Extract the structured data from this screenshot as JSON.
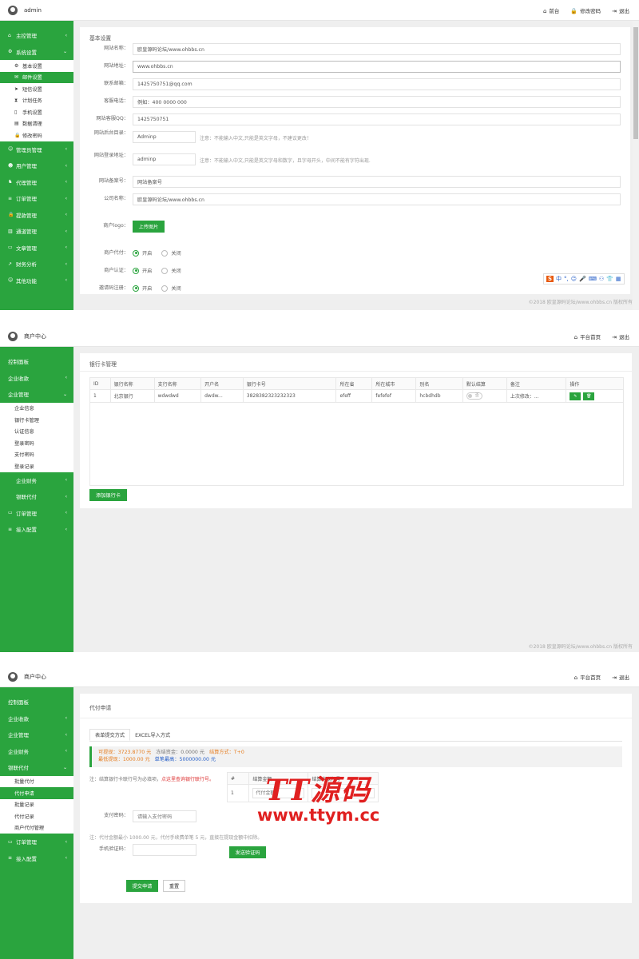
{
  "panel1": {
    "user": "admin",
    "top_links": [
      {
        "icon": "home-icon",
        "glyph": "⌂",
        "label": "前台"
      },
      {
        "icon": "lock-icon",
        "glyph": "🔒",
        "label": "修改密码"
      },
      {
        "icon": "logout-icon",
        "glyph": "⇥",
        "label": "退出"
      }
    ],
    "nav_top": [
      {
        "label": "主控管理",
        "icon": "home-icon",
        "glyph": "⌂",
        "chev": "‹"
      },
      {
        "label": "系统设置",
        "icon": "gears-icon",
        "glyph": "⚙",
        "chev": "⌄"
      }
    ],
    "sub_items": [
      {
        "label": "基本设置",
        "icon": "gear-icon",
        "glyph": "⚙",
        "active": false
      },
      {
        "label": "邮件设置",
        "icon": "envelope-icon",
        "glyph": "✉",
        "active": true
      },
      {
        "label": "短信设置",
        "icon": "paper-plane-icon",
        "glyph": "➤",
        "active": false
      },
      {
        "label": "计划任务",
        "icon": "hourglass-icon",
        "glyph": "⧗",
        "active": false
      },
      {
        "label": "手机设置",
        "icon": "mobile-icon",
        "glyph": "▯",
        "active": false
      },
      {
        "label": "数据清理",
        "icon": "database-icon",
        "glyph": "▤",
        "active": false
      },
      {
        "label": "修改密码",
        "icon": "lock-icon",
        "glyph": "🔒",
        "active": false
      }
    ],
    "nav_bottom": [
      {
        "label": "管理员管理",
        "icon": "user-shield-icon",
        "glyph": "☺"
      },
      {
        "label": "用户管理",
        "icon": "users-icon",
        "glyph": "☻"
      },
      {
        "label": "代理管理",
        "icon": "agent-icon",
        "glyph": "♞"
      },
      {
        "label": "订单管理",
        "icon": "list-icon",
        "glyph": "≡"
      },
      {
        "label": "提款管理",
        "icon": "lock-icon",
        "glyph": "🔒"
      },
      {
        "label": "通道管理",
        "icon": "bank-icon",
        "glyph": "▥"
      },
      {
        "label": "文章管理",
        "icon": "folder-icon",
        "glyph": "▭"
      },
      {
        "label": "财务分析",
        "icon": "chart-icon",
        "glyph": "↗"
      },
      {
        "label": "其他功能",
        "icon": "user-icon",
        "glyph": "☺"
      }
    ],
    "card_title": "基本设置",
    "fields": [
      {
        "label": "网站名称：",
        "value": "欧皇源码论坛/www.ohbbs.cn",
        "note": ""
      },
      {
        "label": "网站地址：",
        "value": "www.ohbbs.cn",
        "note": ""
      },
      {
        "label": "联系邮箱：",
        "value": "1425750751@qq.com",
        "note": ""
      },
      {
        "label": "客服电话：",
        "value": "例如：400 0000 000",
        "note": ""
      },
      {
        "label": "网站客服QQ：",
        "value": "1425750751",
        "note": ""
      },
      {
        "label": "网站后台目录：",
        "value": "Adminp",
        "note": "注意：不能输入中文,只能是英文字母，不建议更改！"
      },
      {
        "label": "网站登录地址：",
        "value": "adminp",
        "note": "注意：不能输入中文,只能是英文字母和数字，且字母开头，中间不能有字符出现."
      },
      {
        "label": "网站备案号：",
        "value": "网站备案号",
        "note": ""
      },
      {
        "label": "公司名称：",
        "value": "欧皇源码论坛/www.ohbbs.cn",
        "note": ""
      }
    ],
    "logo_label": "商户logo：",
    "upload_label": "上传图片",
    "radios": [
      {
        "label": "商户代付：",
        "on": "开启",
        "off": "关闭"
      },
      {
        "label": "商户认证：",
        "on": "开启",
        "off": "关闭"
      },
      {
        "label": "邀请码注册：",
        "on": "开启",
        "off": "关闭"
      }
    ],
    "ime": {
      "s_glyph": "S",
      "items": [
        "中",
        "°,",
        "☺",
        "🎤",
        "⌨",
        "⚇",
        "👕",
        "▦"
      ]
    },
    "footer": "©2018 欧皇源码论坛/www.ohbbs.cn 版权所有"
  },
  "panel2": {
    "user": "商户中心",
    "top_links": [
      {
        "icon": "home-icon",
        "glyph": "⌂",
        "label": "平台首页"
      },
      {
        "icon": "logout-icon",
        "glyph": "⇥",
        "label": "退出"
      }
    ],
    "nav_top": [
      {
        "label": "控制面板",
        "chev": ""
      },
      {
        "label": "企业收款",
        "chev": "‹"
      },
      {
        "label": "企业管理",
        "chev": "⌄"
      }
    ],
    "sub_items": [
      {
        "label": "企业信息"
      },
      {
        "label": "银行卡管理"
      },
      {
        "label": "认证信息"
      },
      {
        "label": "登录密码"
      },
      {
        "label": "支付密码"
      },
      {
        "label": "登录记录"
      }
    ],
    "nav_bottom": [
      {
        "label": "企业财务",
        "icon": "",
        "glyph": ""
      },
      {
        "label": "银联代付",
        "icon": "",
        "glyph": ""
      },
      {
        "label": "订单管理",
        "icon": "card-icon",
        "glyph": "▭"
      },
      {
        "label": "接入配置",
        "icon": "list-icon",
        "glyph": "≡"
      }
    ],
    "card_title": "银行卡管理",
    "table": {
      "headers": [
        "ID",
        "银行名称",
        "支行名称",
        "开户名",
        "银行卡号",
        "所在省",
        "所在城市",
        "别名",
        "默认结算",
        "备注",
        "操作"
      ],
      "rows": [
        {
          "id": "1",
          "bank": "北京银行",
          "branch": "wdwdwd",
          "holder": "dwdw...",
          "card": "3828382323232323",
          "province": "efeff",
          "city": "fefefef",
          "alias": "hcbdhdb",
          "default": "否",
          "note": "上次修改：..."
        }
      ]
    },
    "add_button": "添加银行卡",
    "footer": "©2018 欧皇源码论坛/www.ohbbs.cn 版权所有"
  },
  "panel3": {
    "user": "商户中心",
    "top_links": [
      {
        "icon": "home-icon",
        "glyph": "⌂",
        "label": "平台首页"
      },
      {
        "icon": "logout-icon",
        "glyph": "⇥",
        "label": "退出"
      }
    ],
    "nav_top": [
      {
        "label": "控制面板",
        "chev": ""
      },
      {
        "label": "企业收款",
        "chev": "‹"
      },
      {
        "label": "企业管理",
        "chev": "‹"
      },
      {
        "label": "企业财务",
        "chev": "‹"
      },
      {
        "label": "银联代付",
        "chev": "⌄"
      }
    ],
    "sub_items": [
      {
        "label": "批量代付",
        "active": false
      },
      {
        "label": "代付申请",
        "active": true
      },
      {
        "label": "批量记录",
        "active": false
      },
      {
        "label": "代付记录",
        "active": false
      },
      {
        "label": "商户代付管理",
        "active": false
      }
    ],
    "nav_bottom": [
      {
        "label": "订单管理",
        "icon": "card-icon",
        "glyph": "▭"
      },
      {
        "label": "接入配置",
        "icon": "list-icon",
        "glyph": "≡"
      }
    ],
    "card_title": "代付申请",
    "tabs": [
      "表单提交方式",
      "EXCEL导入方式"
    ],
    "info": {
      "available": "可提现：3723.8770 元",
      "frozen": "冻结资金：0.0000 元",
      "settle": "结算方式：T+0",
      "min": "最低提现：1000.00 元",
      "max": "单笔最高：5000000.00 元"
    },
    "note1_prefix": "注：结算银行卡联行号为必填项，",
    "note1_link": "点这里查询银行联行号。",
    "mini_table": {
      "headers": [
        "#",
        "结算金额",
        "结算卡联行号"
      ],
      "row": [
        "1",
        "代付金额"
      ]
    },
    "paypwd_label": "支付密码：",
    "paypwd_placeholder": "请输入支付密码",
    "note2": "注：代付金额最小 1000.00 元，代付手续费单笔 5 元，直接在提现金额中扣除。",
    "sms_label": "手机验证码：",
    "send_code": "发送验证码",
    "submit": "提交申请",
    "reset": "重置"
  },
  "watermark": {
    "line1": "TT源码",
    "line2": "www.ttym.cc"
  }
}
